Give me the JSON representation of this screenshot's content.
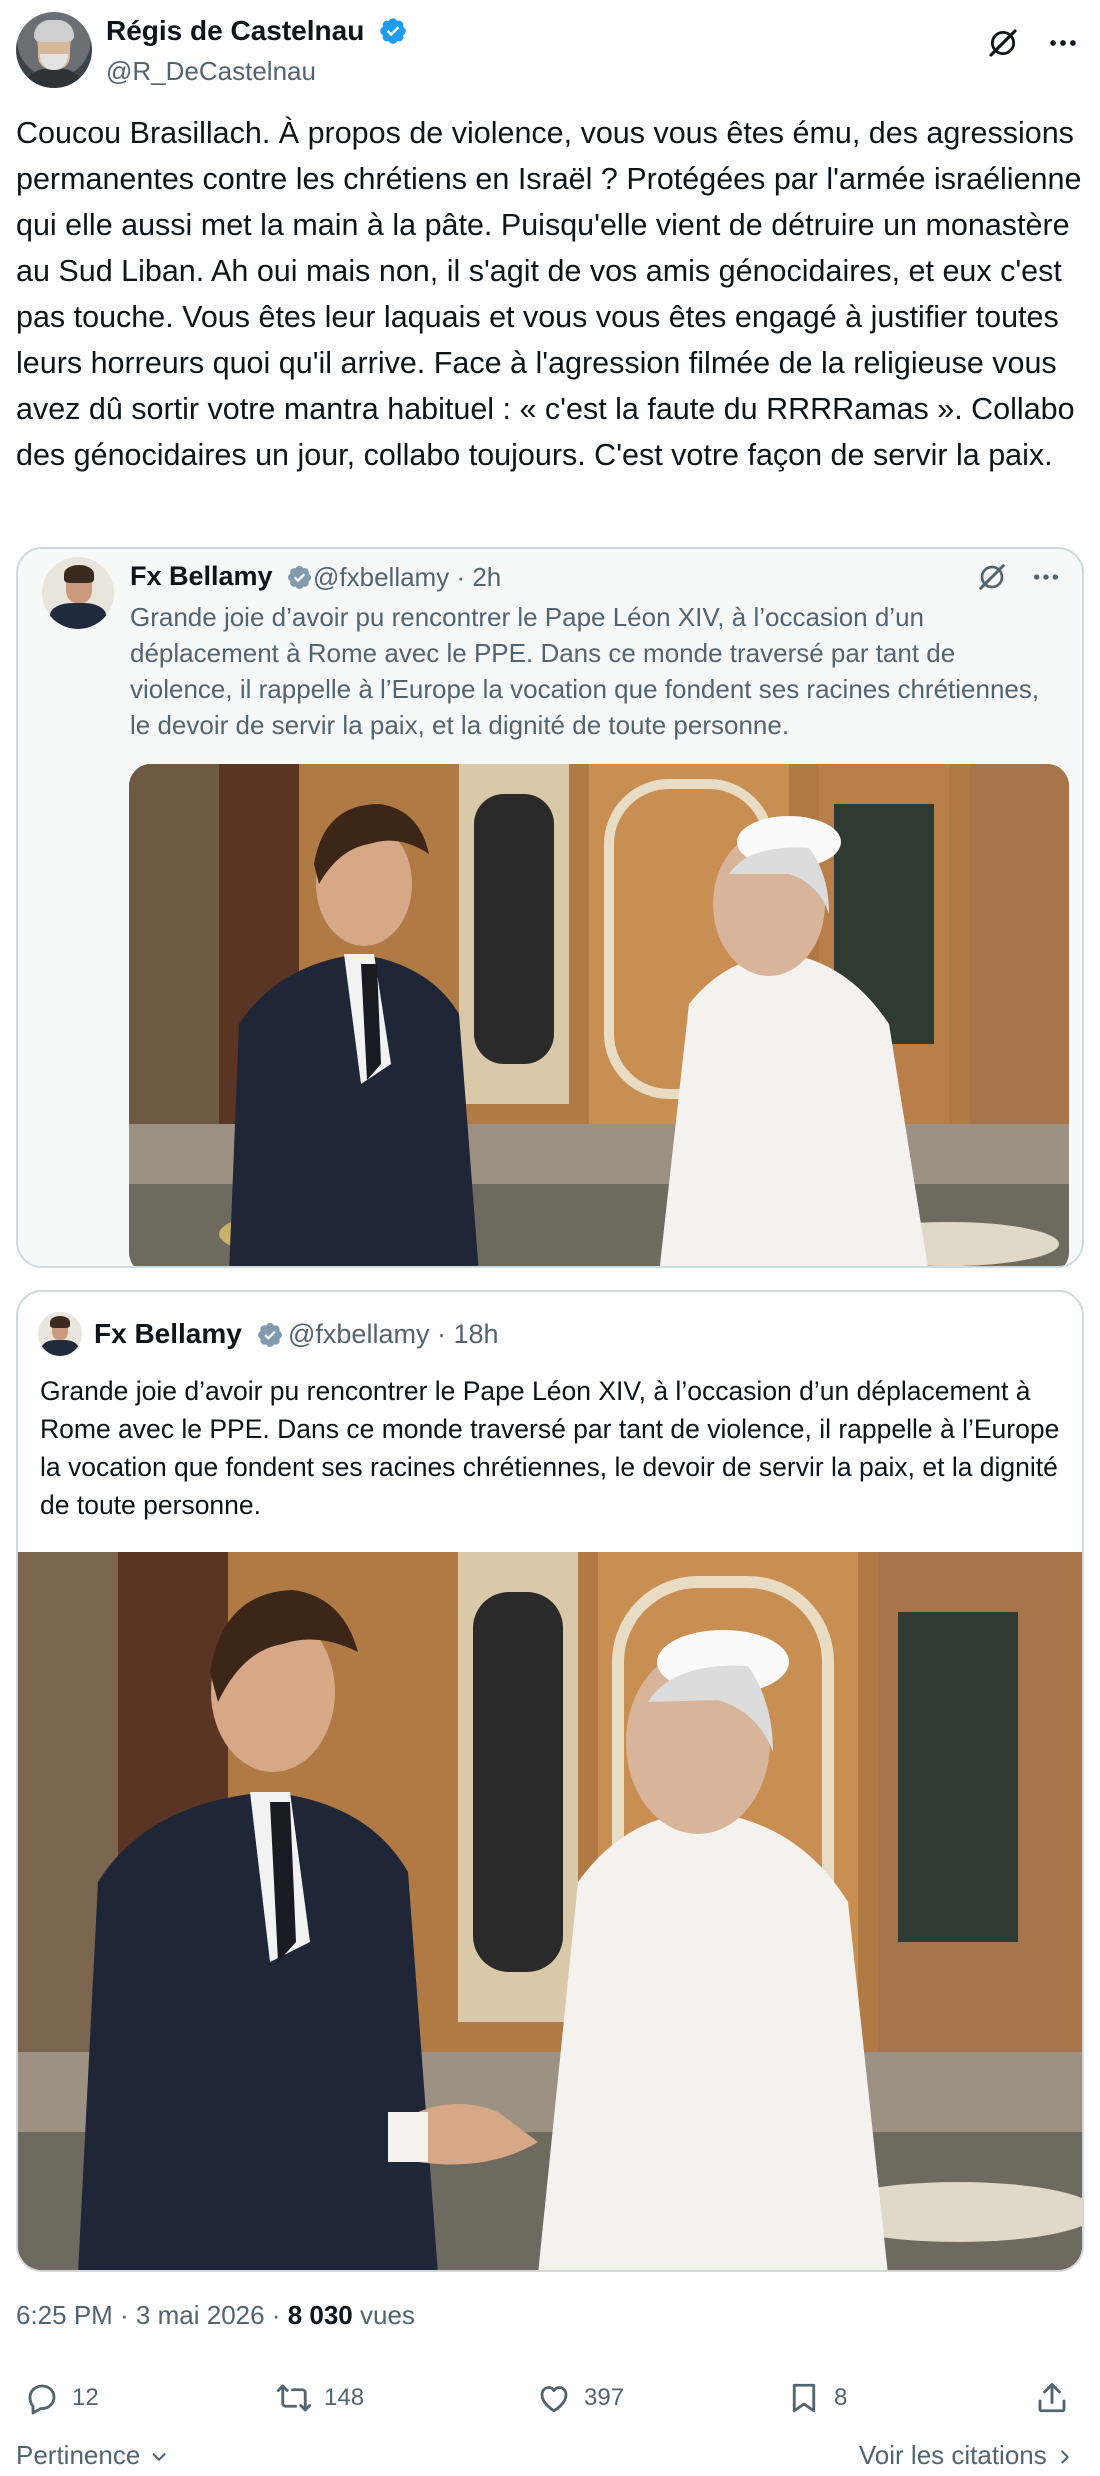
{
  "author": {
    "name": "Régis de Castelnau",
    "handle": "@R_DeCastelnau"
  },
  "tweet": {
    "text": "Coucou Brasillach. À propos de violence, vous vous êtes ému, des agressions permanentes contre les chrétiens en Israël ? Protégées par l'armée israélienne qui elle aussi met la main à la pâte. Puisqu'elle vient de détruire un monastère au Sud Liban. Ah oui mais non, il s'agit de vos amis génocidaires, et eux c'est pas touche. Vous êtes leur laquais et vous vous êtes engagé à justifier toutes leurs horreurs quoi qu'il arrive. Face à l'agression filmée de la religieuse vous avez dû sortir votre mantra habituel : « c'est la faute du RRRRamas ». Collabo des génocidaires un jour, collabo toujours. C'est votre façon de servir la paix."
  },
  "quote1": {
    "name": "Fx Bellamy",
    "handle_time": "@fxbellamy · 2h",
    "text": "Grande joie d’avoir pu rencontrer le Pape Léon XIV, à l’occasion d’un déplacement à Rome avec le PPE. Dans ce monde traversé par tant de violence, il rappelle à l’Europe la vocation que fondent ses racines chrétiennes, le devoir de servir la paix, et la dignité de toute personne."
  },
  "quote2": {
    "name": "Fx Bellamy",
    "handle_time": "@fxbellamy · 18h",
    "text": "Grande joie d’avoir pu rencontrer le Pape Léon XIV, à l’occasion d’un déplacement à Rome avec le PPE. Dans ce monde traversé par tant de violence, il rappelle à l’Europe la vocation que fondent ses racines chrétiennes, le devoir de servir la paix, et la dignité de toute personne."
  },
  "meta": {
    "time_date": "6:25 PM · 3 mai 2026 · ",
    "views_count": "8 030",
    "views_label": " vues"
  },
  "actions": {
    "replies": "12",
    "reposts": "148",
    "likes": "397",
    "bookmarks": "8"
  },
  "footer": {
    "sort_label": "Pertinence",
    "quotes_label": "Voir les citations"
  },
  "icons": [
    "verified-badge-icon",
    "grok-icon",
    "more-icon",
    "reply-icon",
    "repost-icon",
    "like-icon",
    "bookmark-icon",
    "share-icon",
    "chevron-down-icon",
    "chevron-right-icon"
  ],
  "colors": {
    "text": "#0f1419",
    "secondary": "#536471",
    "border": "#cfd9de",
    "verified": "#1d9bf0"
  }
}
